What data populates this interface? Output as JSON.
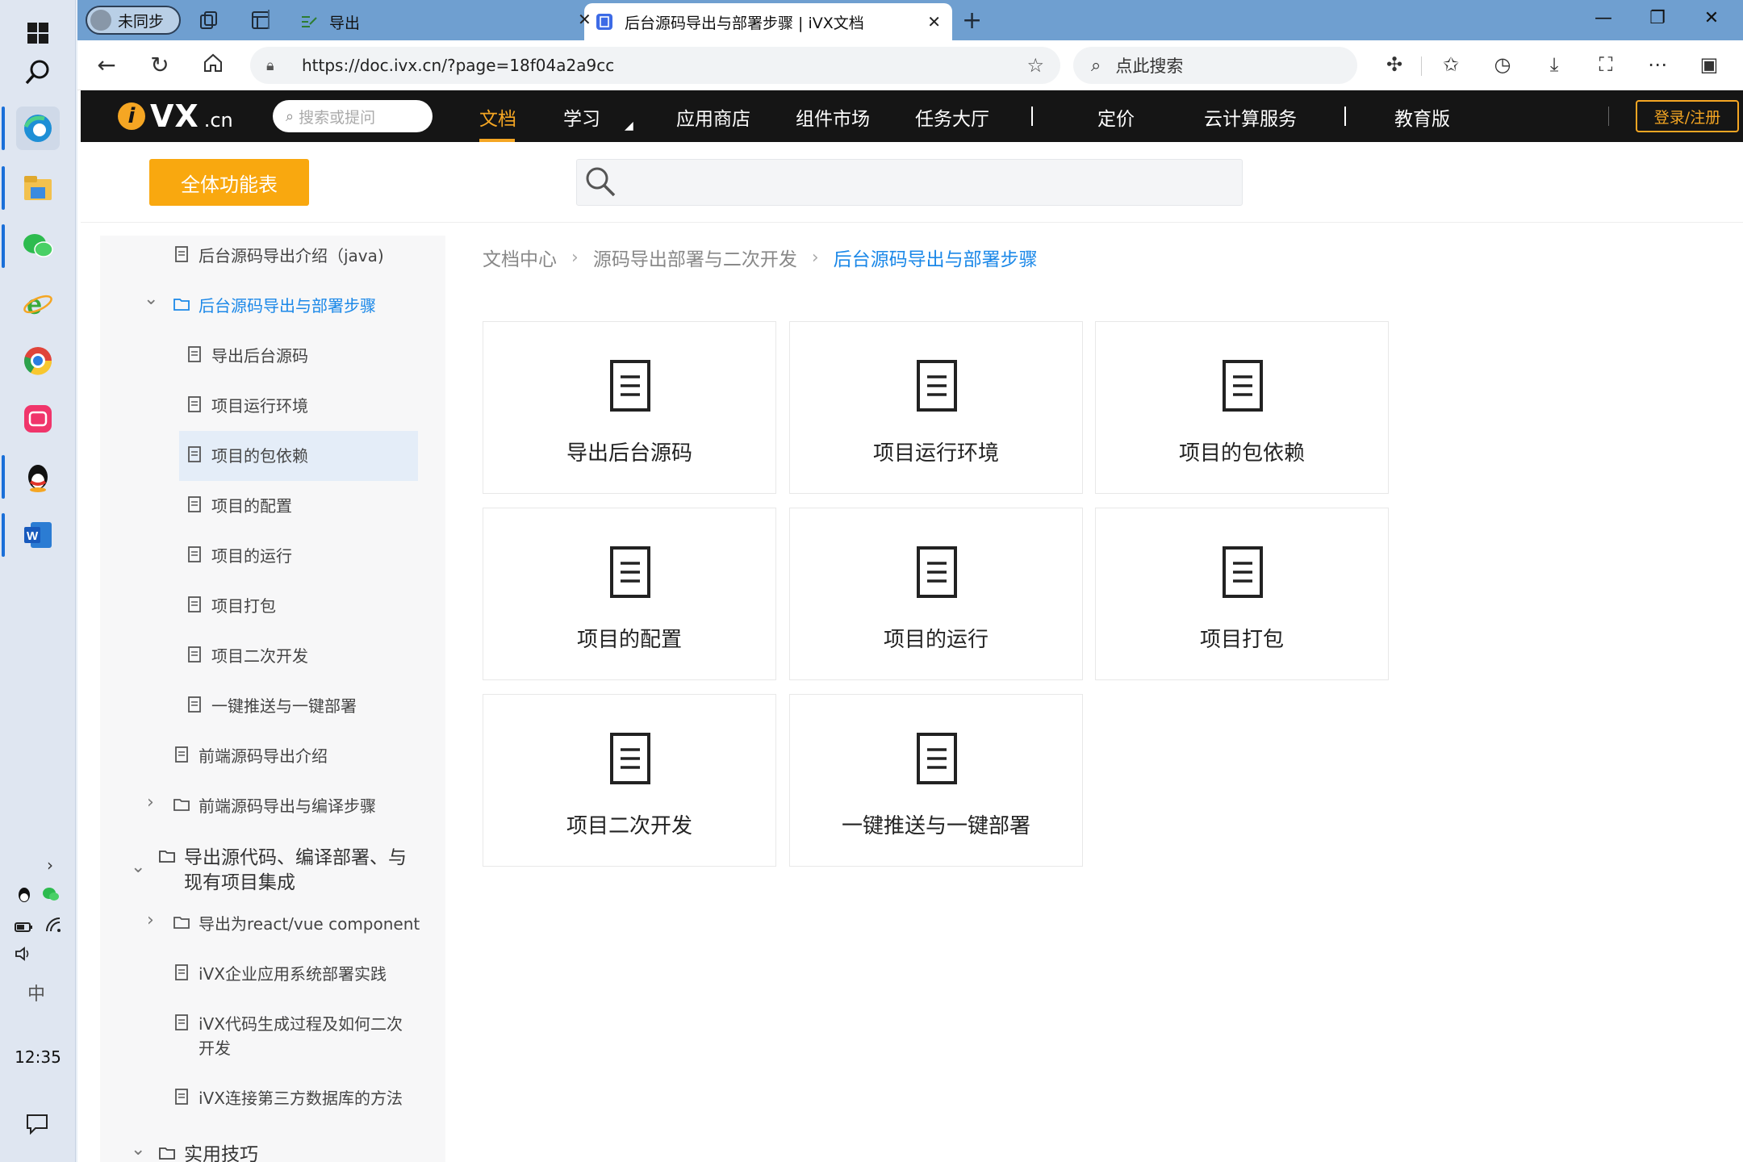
{
  "taskbar": {
    "clock": "12:35",
    "ime": "中"
  },
  "browser": {
    "profile_label": "未同步",
    "tabs": [
      {
        "title": "导出"
      },
      {
        "title": "后台源码导出与部署步骤 | iVX文档"
      }
    ],
    "url": "https://doc.ivx.cn/?page=18f04a2a9cc",
    "search_placeholder": "点此搜索"
  },
  "site": {
    "logo": {
      "vx": "VX",
      "cn": ".cn"
    },
    "search_placeholder": "搜索或提问",
    "menu": [
      "文档",
      "学习",
      "应用商店",
      "组件市场",
      "任务大厅",
      "定价",
      "云计算服务",
      "教育版"
    ],
    "login": "登录/注册",
    "all_functions": "全体功能表"
  },
  "sidebar": {
    "items": [
      {
        "label": "后台源码导出介绍（java)"
      },
      {
        "label": "后台源码导出与部署步骤"
      },
      {
        "label": "导出后台源码"
      },
      {
        "label": "项目运行环境"
      },
      {
        "label": "项目的包依赖"
      },
      {
        "label": "项目的配置"
      },
      {
        "label": "项目的运行"
      },
      {
        "label": "项目打包"
      },
      {
        "label": "项目二次开发"
      },
      {
        "label": "一键推送与一键部署"
      },
      {
        "label": "前端源码导出介绍"
      },
      {
        "label": "前端源码导出与编译步骤"
      },
      {
        "label": "导出源代码、编译部署、与现有项目集成"
      },
      {
        "label": "导出为react/vue component"
      },
      {
        "label": "iVX企业应用系统部署实践"
      },
      {
        "label": "iVX代码生成过程及如何二次开发"
      },
      {
        "label": "iVX连接第三方数据库的方法"
      },
      {
        "label": "实用技巧"
      }
    ]
  },
  "breadcrumb": {
    "items": [
      "文档中心",
      "源码导出部署与二次开发",
      "后台源码导出与部署步骤"
    ]
  },
  "cards": [
    {
      "label": "导出后台源码"
    },
    {
      "label": "项目运行环境"
    },
    {
      "label": "项目的包依赖"
    },
    {
      "label": "项目的配置"
    },
    {
      "label": "项目的运行"
    },
    {
      "label": "项目打包"
    },
    {
      "label": "项目二次开发"
    },
    {
      "label": "一键推送与一键部署"
    }
  ],
  "colors": {
    "accent": "#f9a80f",
    "link": "#1b88e8",
    "header_bg": "#151515",
    "tabstrip": "#6f9fd0"
  }
}
